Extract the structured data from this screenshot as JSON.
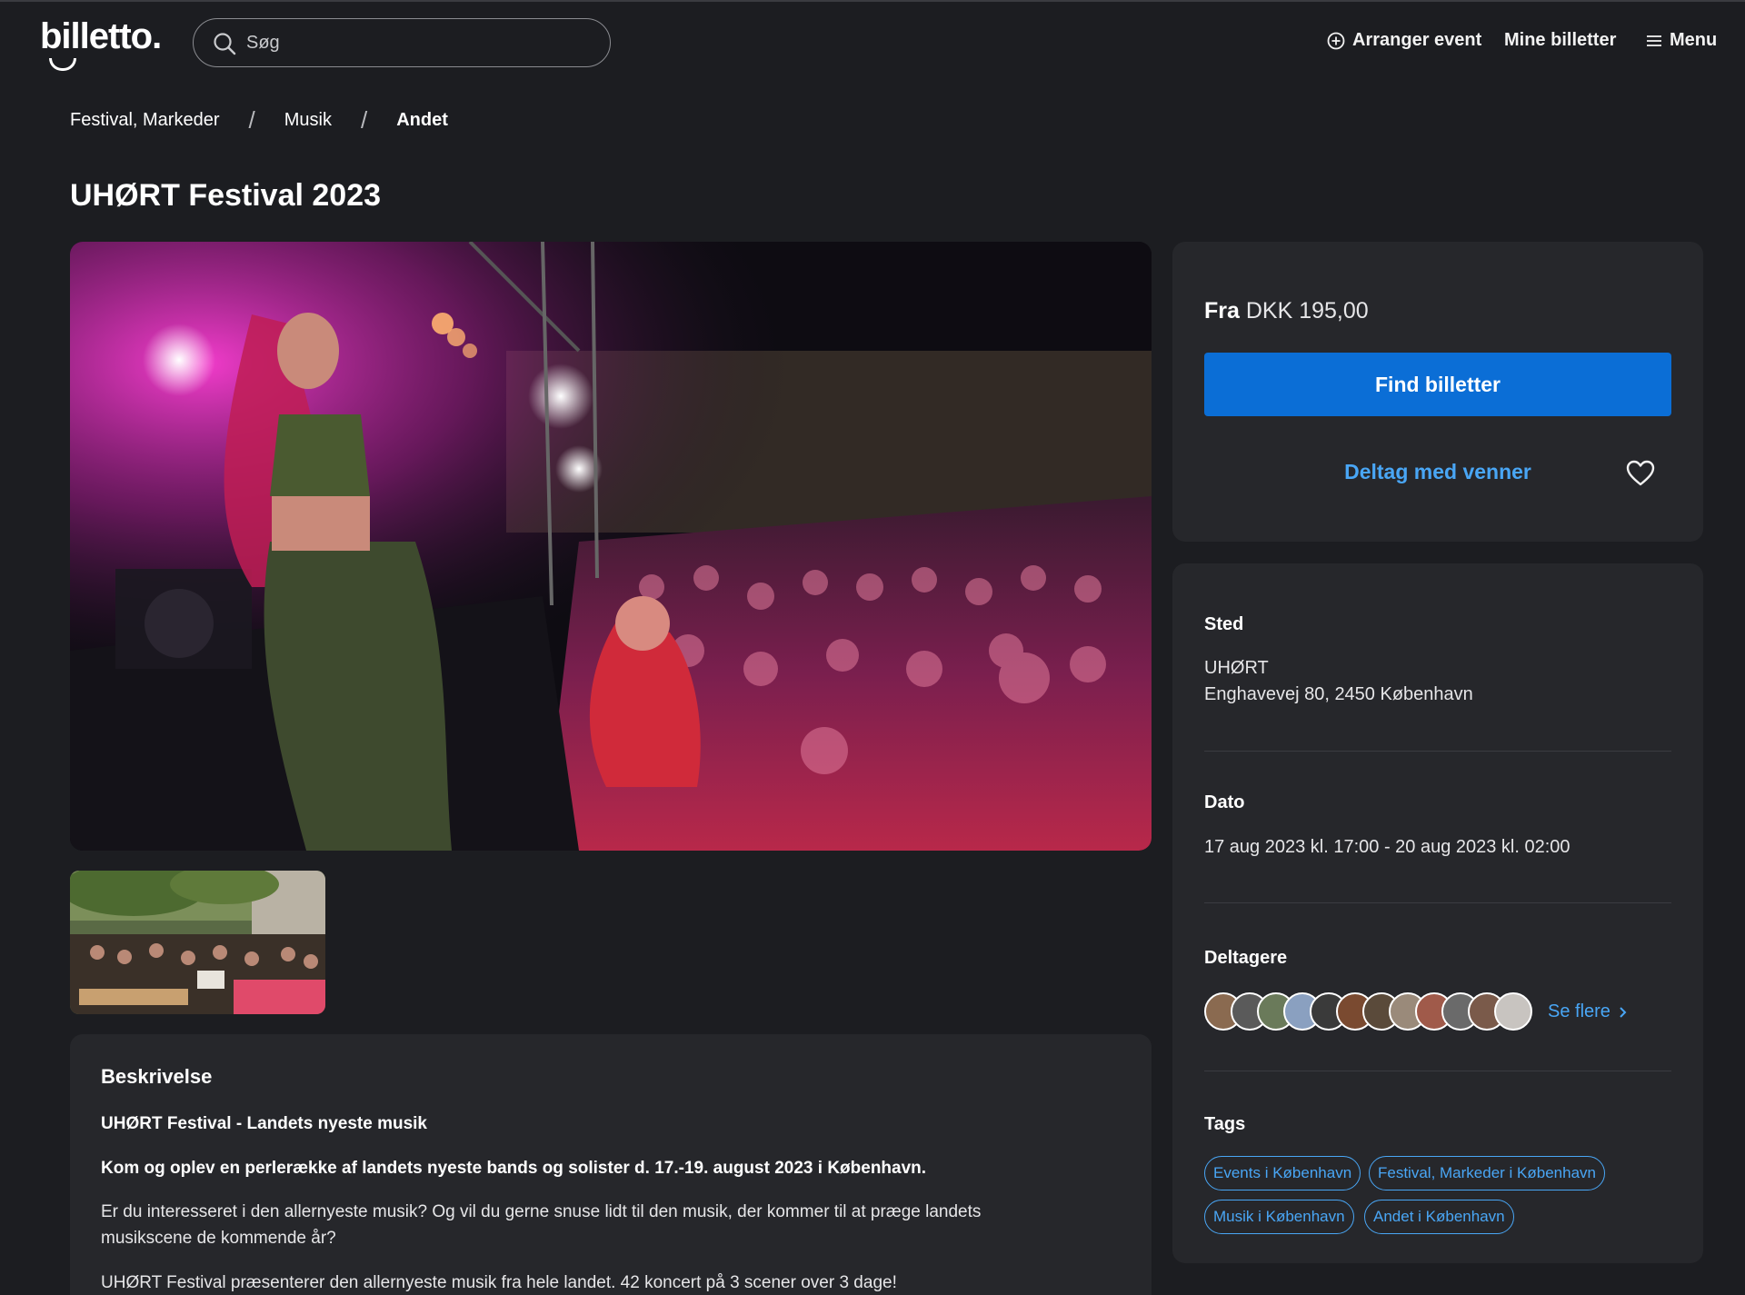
{
  "header": {
    "logo_text": "billetto.",
    "search_placeholder": "Søg",
    "arranger_label": "Arranger event",
    "mine_billetter_label": "Mine billetter",
    "menu_label": "Menu"
  },
  "breadcrumb": {
    "items": [
      "Festival, Markeder",
      "Musik",
      "Andet"
    ],
    "separator": "/"
  },
  "event": {
    "title": "UHØRT Festival 2023"
  },
  "booking": {
    "price_prefix": "Fra",
    "price_value": "DKK 195,00",
    "find_tickets_label": "Find billetter",
    "join_friends_label": "Deltag med venner"
  },
  "details": {
    "venue_heading": "Sted",
    "venue_name": "UHØRT",
    "venue_address": "Enghavevej 80, 2450 København",
    "date_heading": "Dato",
    "date_value": "17 aug 2023 kl. 17:00 - 20 aug 2023 kl. 02:00",
    "attendees_heading": "Deltagere",
    "see_more_label": "Se flere",
    "tags_heading": "Tags",
    "tags": [
      "Events i København",
      "Festival, Markeder i København",
      "Musik i København",
      "Andet i København"
    ]
  },
  "description": {
    "heading": "Beskrivelse",
    "subtitle": "UHØRT Festival - Landets nyeste musik",
    "lead": "Kom og oplev en perlerække af landets nyeste bands og solister d. 17.-19. august 2023 i København.",
    "paragraph1": "Er du interesseret i den allernyeste musik? Og vil du gerne snuse lidt til den musik, der kommer til at præge landets musikscene de kommende år?",
    "paragraph2": "UHØRT Festival præsenterer den allernyeste musik fra hele landet. 42 koncert på 3 scener over 3 dage!"
  },
  "colors": {
    "background": "#1c1d21",
    "card": "#26272b",
    "primary_button": "#0b6ed6",
    "link": "#49a6f5"
  }
}
